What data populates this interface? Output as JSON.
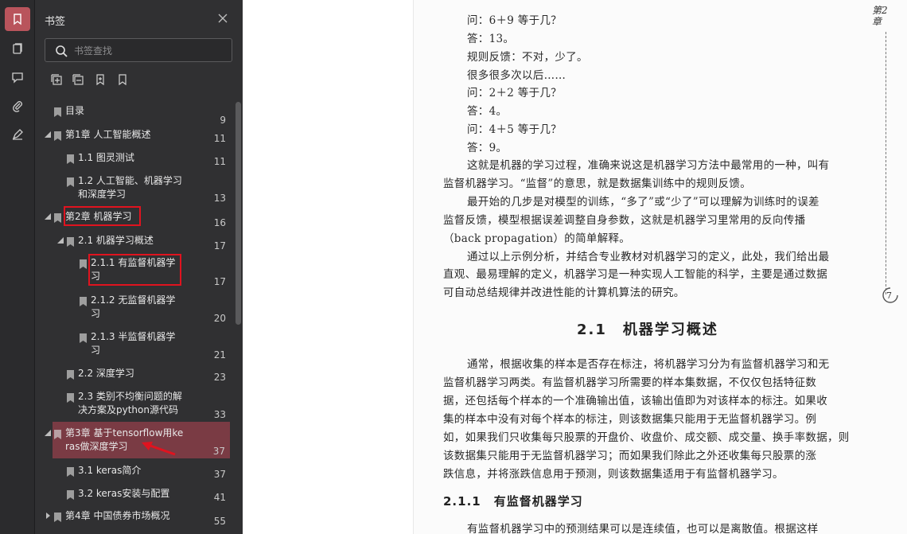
{
  "rail": {
    "icons": [
      "bookmark-icon",
      "pages-icon",
      "comment-icon",
      "attachment-icon",
      "signature-icon"
    ]
  },
  "panel": {
    "title": "书签",
    "search_placeholder": "书签查找",
    "tools": [
      "expand-all-icon",
      "collapse-all-icon",
      "add-bookmark-icon",
      "bookmark-outline-icon"
    ]
  },
  "bookmarks": [
    {
      "label": "目录",
      "page": "9"
    },
    {
      "label": "第1章 人工智能概述",
      "page": "11"
    },
    {
      "label": "1.1 图灵测试",
      "page": "11"
    },
    {
      "label1": "1.2 人工智能、机器学习",
      "label2": "和深度学习",
      "page": "13"
    },
    {
      "label": "第2章 机器学习",
      "page": "16"
    },
    {
      "label": "2.1 机器学习概述",
      "page": "17"
    },
    {
      "label1": "2.1.1 有监督机器学",
      "label2": "习",
      "page": "17"
    },
    {
      "label1": "2.1.2 无监督机器学",
      "label2": "习",
      "page": "20"
    },
    {
      "label1": "2.1.3 半监督机器学",
      "label2": "习",
      "page": "21"
    },
    {
      "label": "2.2 深度学习",
      "page": "23"
    },
    {
      "label1": "2.3 类别不均衡问题的解",
      "label2": "决方案及python源代码",
      "page": "33"
    },
    {
      "label1": "第3章 基于tensorflow用ke",
      "label2": "ras做深度学习",
      "page": "37"
    },
    {
      "label": "3.1 keras简介",
      "page": "37"
    },
    {
      "label": "3.2 keras安装与配置",
      "page": "41"
    },
    {
      "label": "第4章 中国债券市场概况",
      "page": "55"
    }
  ],
  "document": {
    "lines": [
      "问：6＋9 等于几？",
      "答：13。",
      "规则反馈：不对，少了。",
      "很多很多次以后……",
      "问：2＋2 等于几？",
      "答：4。",
      "问：4＋5 等于几？",
      "答：9。",
      "这就是机器的学习过程，准确来说这是机器学习方法中最常用的一种，叫有",
      "监督机器学习。“监督”的意思，就是数据集训练中的规则反馈。",
      "最开始的几步是对模型的训练，“多了”或“少了”可以理解为训练时的误差",
      "监督反馈，模型根据误差调整自身参数，这就是机器学习里常用的反向传播",
      "（back propagation）的简单解释。",
      "通过以上示例分析，并结合专业教材对机器学习的定义，此处，我们给出最",
      "直观、最易理解的定义，机器学习是一种实现人工智能的科学，主要是通过数据",
      "可自动总结规律并改进性能的计算机算法的研究。",
      "通常，根据收集的样本是否存在标注，将机器学习分为有监督机器学习和无",
      "监督机器学习两类。有监督机器学习所需要的样本集数据，不仅仅包括特征数",
      "据，还包括每个样本的一个准确输出值，该输出值即为对该样本的标注。如果收",
      "集的样本中没有对每个样本的标注，则该数据集只能用于无监督机器学习。例",
      "如，如果我们只收集每只股票的开盘价、收盘价、成交额、成交量、换手率数据，则",
      "该数据集只能用于无监督机器学习；而如果我们除此之外还收集每只股票的涨",
      "跌信息，并将涨跌信息用于预测，则该数据集适用于有监督机器学习。",
      "有监督机器学习中的预测结果可以是连续值，也可以是离散值。根据这样"
    ],
    "heading1": "2.1　机器学习概述",
    "heading2": "2.1.1　有监督机器学习",
    "chapter_tab": "第2章",
    "page_number": "7"
  },
  "colors": {
    "accent": "#b9545c",
    "selected_row": "#7a3b44",
    "annotation_red": "#e0131f"
  }
}
